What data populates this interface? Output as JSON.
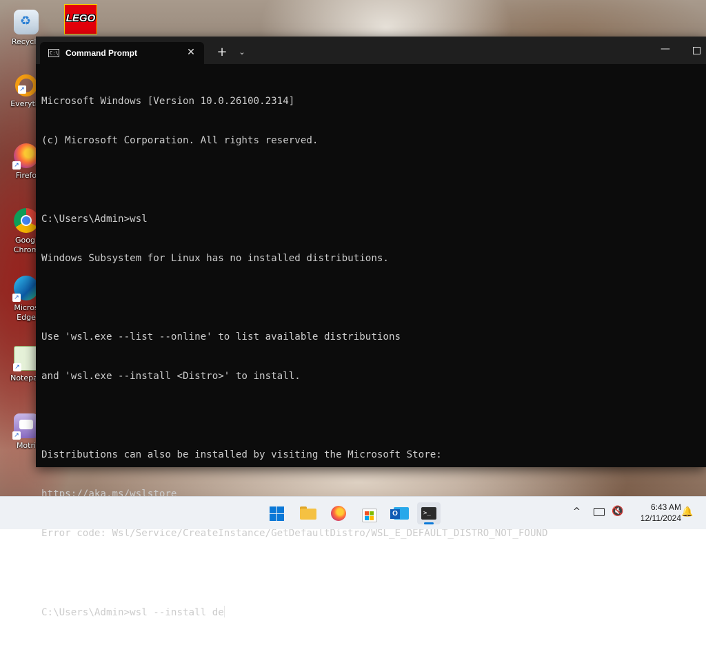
{
  "desktop": {
    "icons": [
      {
        "label": "Recycle",
        "icon": "recycle-bin-icon"
      },
      {
        "label": "Everythi",
        "icon": "everything-search-icon"
      },
      {
        "label": "Firefo",
        "icon": "firefox-icon"
      },
      {
        "label": "Googl\nChrom",
        "icon": "chrome-icon"
      },
      {
        "label": "Micros\nEdge",
        "icon": "edge-icon"
      },
      {
        "label": "Notepac",
        "icon": "notepad-icon"
      },
      {
        "label": "Motri",
        "icon": "motrix-icon"
      }
    ],
    "lego_label": "LEGO"
  },
  "window": {
    "tab_title": "Command Prompt",
    "tab_icon_glyph": "C:\\",
    "close_glyph": "✕",
    "new_tab_glyph": "+",
    "dropdown_glyph": "⌄",
    "minimize_glyph": "—"
  },
  "console": {
    "lines": [
      "Microsoft Windows [Version 10.0.26100.2314]",
      "(c) Microsoft Corporation. All rights reserved.",
      "",
      "C:\\Users\\Admin>wsl",
      "Windows Subsystem for Linux has no installed distributions.",
      "",
      "Use 'wsl.exe --list --online' to list available distributions",
      "and 'wsl.exe --install <Distro>' to install.",
      "",
      "Distributions can also be installed by visiting the Microsoft Store:",
      "https://aka.ms/wslstore",
      "Error code: Wsl/Service/CreateInstance/GetDefaultDistro/WSL_E_DEFAULT_DISTRO_NOT_FOUND",
      ""
    ],
    "prompt": "C:\\Users\\Admin>",
    "current_input": "wsl --install de"
  },
  "taskbar": {
    "apps": [
      "start-icon",
      "file-explorer-icon",
      "firefox-icon",
      "microsoft-store-icon",
      "outlook-icon",
      "terminal-icon"
    ],
    "tray_chevron": "^",
    "time": "6:43 AM",
    "date": "12/11/2024"
  },
  "colors": {
    "console_bg": "#0c0c0c",
    "console_text": "#cccccc",
    "titlebar_bg": "#1f1f1f",
    "taskbar_bg": "#eef1f5",
    "accent": "#0a78d7"
  }
}
